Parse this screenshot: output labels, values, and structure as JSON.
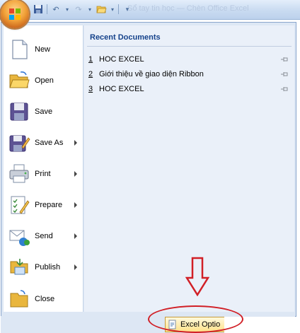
{
  "window": {
    "title": "Sổ tay tin học — Chèn Office Excel"
  },
  "qat": {
    "items": [
      "save-icon",
      "undo-icon",
      "redo-icon",
      "open-icon",
      "customize-icon"
    ]
  },
  "menu": {
    "commands": [
      {
        "key": "new",
        "label": "New",
        "has_submenu": false
      },
      {
        "key": "open",
        "label": "Open",
        "has_submenu": false
      },
      {
        "key": "save",
        "label": "Save",
        "has_submenu": false
      },
      {
        "key": "save_as",
        "label": "Save As",
        "has_submenu": true
      },
      {
        "key": "print",
        "label": "Print",
        "has_submenu": true
      },
      {
        "key": "prepare",
        "label": "Prepare",
        "has_submenu": true
      },
      {
        "key": "send",
        "label": "Send",
        "has_submenu": true
      },
      {
        "key": "publish",
        "label": "Publish",
        "has_submenu": true
      },
      {
        "key": "close",
        "label": "Close",
        "has_submenu": false
      }
    ]
  },
  "recent": {
    "heading": "Recent Documents",
    "documents": [
      {
        "num": "1",
        "name": "HOC EXCEL"
      },
      {
        "num": "2",
        "name": "Giới thiệu về giao diện Ribbon"
      },
      {
        "num": "3",
        "name": "HOC EXCEL"
      }
    ]
  },
  "footer": {
    "options_label": "Excel Optio"
  },
  "colors": {
    "panel": "#dde7f4",
    "recent_bg": "#eaf0f9",
    "heading": "#15428b",
    "annotation": "#d11f26"
  }
}
